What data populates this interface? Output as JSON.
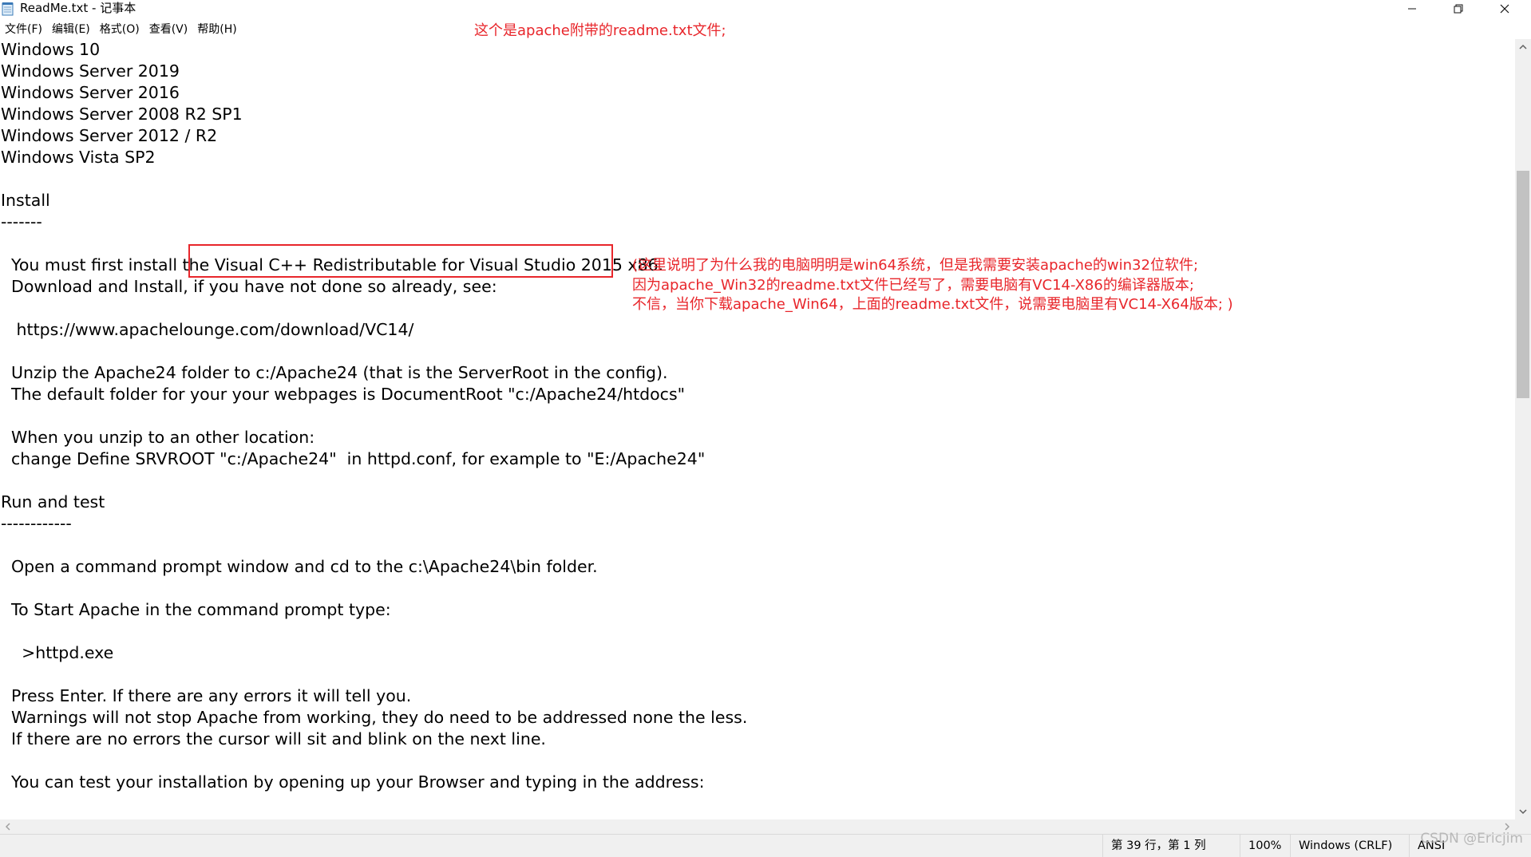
{
  "window": {
    "title": "ReadMe.txt - 记事本"
  },
  "menubar": {
    "items": [
      "文件(F)",
      "编辑(E)",
      "格式(O)",
      "查看(V)",
      "帮助(H)"
    ]
  },
  "editor": {
    "lines": [
      "Windows 10",
      "Windows Server 2019",
      "Windows Server 2016",
      "Windows Server 2008 R2 SP1",
      "Windows Server 2012 / R2",
      "Windows Vista SP2",
      "",
      "Install",
      "-------",
      "",
      "  You must first install the Visual C++ Redistributable for Visual Studio 2015 x86.",
      "  Download and Install, if you have not done so already, see:",
      "",
      "   https://www.apachelounge.com/download/VC14/",
      "",
      "  Unzip the Apache24 folder to c:/Apache24 (that is the ServerRoot in the config).",
      "  The default folder for your your webpages is DocumentRoot \"c:/Apache24/htdocs\"",
      "",
      "  When you unzip to an other location:",
      "  change Define SRVROOT \"c:/Apache24\"  in httpd.conf, for example to \"E:/Apache24\"",
      "",
      "Run and test",
      "------------",
      "",
      "  Open a command prompt window and cd to the c:\\Apache24\\bin folder.",
      "",
      "  To Start Apache in the command prompt type:",
      "",
      "    >httpd.exe",
      "",
      "  Press Enter. If there are any errors it will tell you.",
      "  Warnings will not stop Apache from working, they do need to be addressed none the less.",
      "  If there are no errors the cursor will sit and blink on the next line.",
      "",
      "  You can test your installation by opening up your Browser and typing in the address:"
    ]
  },
  "annotations": {
    "top_note": "这个是apache附带的readme.txt文件;",
    "side_note_lines": [
      "(这里说明了为什么我的电脑明明是win64系统，但是我需要安装apache的win32位软件;",
      "因为apache_Win32的readme.txt文件已经写了，需要电脑有VC14-X86的编译器版本;",
      "不信，当你下载apache_Win64，上面的readme.txt文件，说需要电脑里有VC14-X64版本; )"
    ],
    "color": "#e8262b"
  },
  "statusbar": {
    "position": "第 39 行，第 1 列",
    "zoom": "100%",
    "line_ending": "Windows (CRLF)",
    "encoding": "ANSI"
  },
  "watermark": "CSDN @Ericjim",
  "icons": {
    "app": "notepad-icon",
    "minimize": "minimize-icon",
    "maximize": "restore-icon",
    "close": "close-icon"
  }
}
